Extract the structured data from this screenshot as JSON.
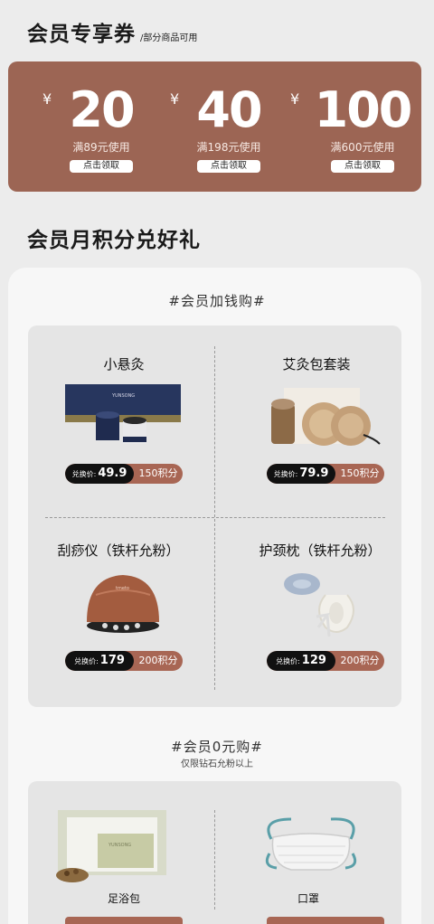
{
  "header": {
    "title": "会员专享券",
    "subtitle": "/部分商品可用"
  },
  "coupons": [
    {
      "yen": "¥",
      "amount": "20",
      "condition": "满89元使用",
      "button": "点击领取"
    },
    {
      "yen": "¥",
      "amount": "40",
      "condition": "满198元使用",
      "button": "点击领取"
    },
    {
      "yen": "¥",
      "amount": "100",
      "condition": "满600元使用",
      "button": "点击领取"
    }
  ],
  "points_section": {
    "title": "会员月积分兑好礼"
  },
  "add_money": {
    "title": "#会员加钱购#",
    "items": [
      {
        "name": "小悬灸",
        "price_label": "兑换价:",
        "price": "49.9",
        "points": "150积分"
      },
      {
        "name": "艾灸包套装",
        "price_label": "兑换价:",
        "price": "79.9",
        "points": "150积分"
      },
      {
        "name": "刮痧仪（铁杆允粉）",
        "price_label": "兑换价:",
        "price": "179",
        "points": "200积分"
      },
      {
        "name": "护颈枕（铁杆允粉）",
        "price_label": "兑换价:",
        "price": "129",
        "points": "200积分"
      }
    ]
  },
  "zero_buy": {
    "title": "#会员0元购#",
    "note": "仅限钻石允粉以上",
    "items": [
      {
        "name": "足浴包"
      },
      {
        "name": "口罩"
      }
    ]
  },
  "colors": {
    "brand": "#9c6554",
    "pill_accent": "#a86654",
    "pill_dark": "#111111",
    "panel_bg": "#e5e5e5"
  }
}
